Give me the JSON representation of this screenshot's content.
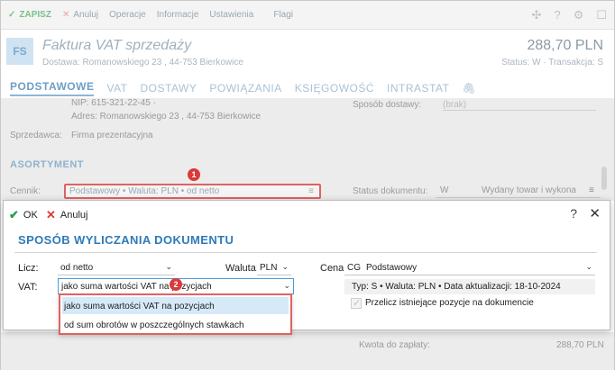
{
  "toolbar": {
    "save": "ZAPISZ",
    "cancel": "Anuluj",
    "operations": "Operacje",
    "info": "Informacje",
    "settings": "Ustawienia",
    "flags": "Flagi"
  },
  "header": {
    "doc_code": "FS",
    "title": "Faktura VAT sprzedaży",
    "delivery": "Dostawa: Romanowskiego 23 , 44-753 Bierkowice",
    "amount": "288,70 PLN",
    "status": "Status: W  ·  Transakcja: S"
  },
  "tabs": [
    "PODSTAWOWE",
    "VAT",
    "DOSTAWY",
    "POWIĄZANIA",
    "KSIĘGOWOŚĆ",
    "INTRASTAT"
  ],
  "background": {
    "nip": "NIP: 615-321-22-45  ·",
    "address": "Adres: Romanowskiego 23 , 44-753 Bierkowice",
    "seller_label": "Sprzedawca:",
    "seller_value": "Firma prezentacyjna",
    "delivery_label": "Sposób dostawy:",
    "delivery_value": "(brak)",
    "section": "ASORTYMENT",
    "cennik_label": "Cennik:",
    "cennik_value": "Podstawowy • Waluta: PLN • od netto",
    "status_label": "Status dokumentu:",
    "status_code": "W",
    "status_value": "Wydany towar i wykona",
    "total_label": "Kwota do zapłaty:",
    "total_value": "288,70 PLN"
  },
  "dialog": {
    "ok": "OK",
    "cancel": "Anuluj",
    "help": "?",
    "close": "✕",
    "title": "SPOSÓB WYLICZANIA DOKUMENTU",
    "licz_label": "Licz:",
    "licz_value": "od netto",
    "waluta_label": "Waluta:",
    "waluta_value": "PLN",
    "cena_label": "Cena:",
    "cena_code": "CG",
    "cena_value": "Podstawowy",
    "vat_label": "VAT:",
    "vat_value": "jako suma wartości VAT na pozycjach",
    "type_info": "Typ: S • Waluta: PLN • Data aktualizacji: 18-10-2024",
    "recalc_label": "Przelicz istniejące pozycje na dokumencie",
    "vat_options": [
      "jako suma wartości VAT na pozycjach",
      "od sum obrotów w poszczególnych stawkach"
    ]
  },
  "badges": [
    "1",
    "2"
  ],
  "colors": {
    "accent": "#2f7ab8",
    "highlight": "#e06262",
    "selected": "#d6e9f8"
  }
}
